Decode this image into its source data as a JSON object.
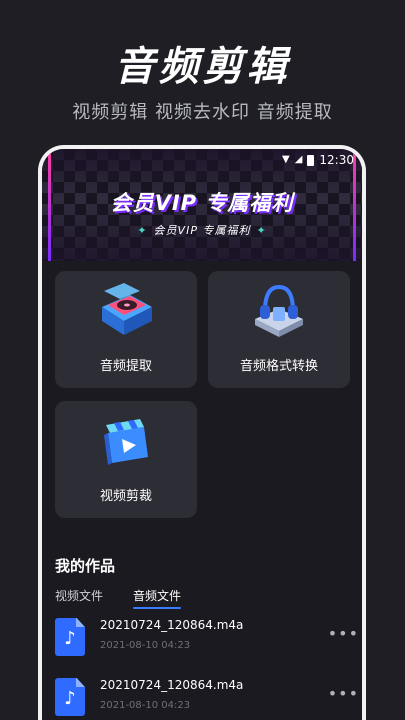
{
  "hero": {
    "title": "音频剪辑",
    "subtitle": "视频剪辑 视频去水印 音频提取"
  },
  "status_bar": {
    "time": "12:30",
    "icons": [
      "wifi-icon",
      "signal-icon",
      "battery-icon"
    ]
  },
  "banner": {
    "title": "会员VIP 专属福利",
    "subtitle": "会员VIP  专属福利"
  },
  "tools": [
    {
      "label": "音频提取",
      "icon": "vinyl-player-icon"
    },
    {
      "label": "音频格式转换",
      "icon": "headphones-icon"
    },
    {
      "label": "视频剪裁",
      "icon": "video-clapper-icon"
    }
  ],
  "works": {
    "title": "我的作品",
    "tabs": [
      {
        "label": "视频文件",
        "active": false
      },
      {
        "label": "音频文件",
        "active": true
      }
    ],
    "files": [
      {
        "name": "20210724_120864.m4a",
        "date": "2021-08-10 04:23"
      },
      {
        "name": "20210724_120864.m4a",
        "date": "2021-08-10 04:23"
      }
    ]
  },
  "colors": {
    "background": "#1e1e24",
    "card": "#2d2d35",
    "accent": "#3b7bff",
    "file_icon": "#2f6bff"
  }
}
